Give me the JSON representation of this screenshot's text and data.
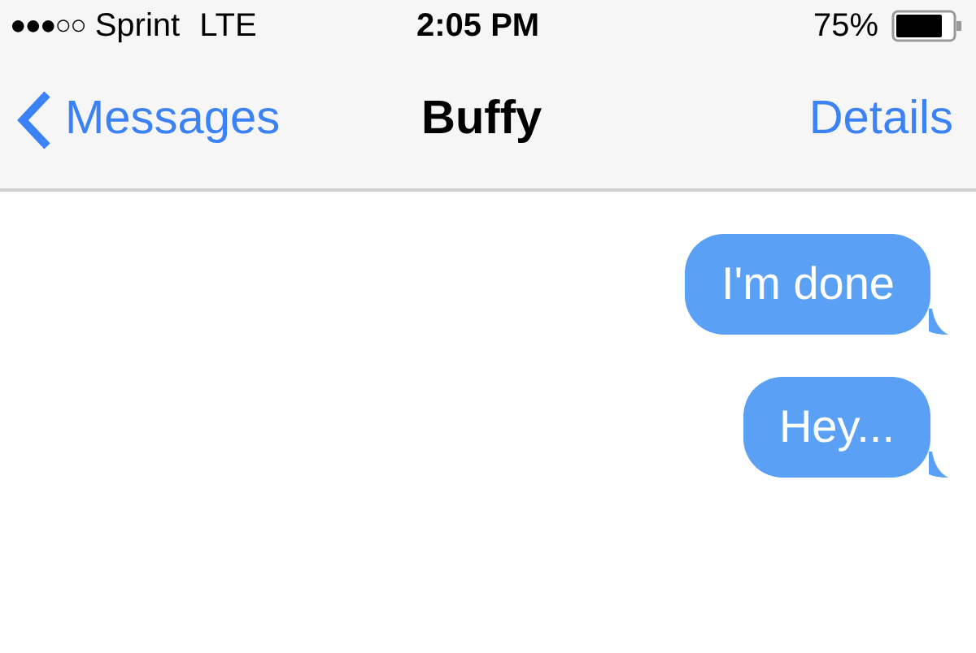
{
  "status_bar": {
    "signal": "●●●○○",
    "carrier": "Sprint",
    "network": "LTE",
    "time": "2:05 PM",
    "battery": "75%"
  },
  "nav_bar": {
    "back": "Messages",
    "title": "Buffy",
    "action": "Details"
  },
  "messages": [
    {
      "text": "I'm done",
      "kind": "sent"
    },
    {
      "text": "Hey...",
      "kind": "sent"
    }
  ]
}
